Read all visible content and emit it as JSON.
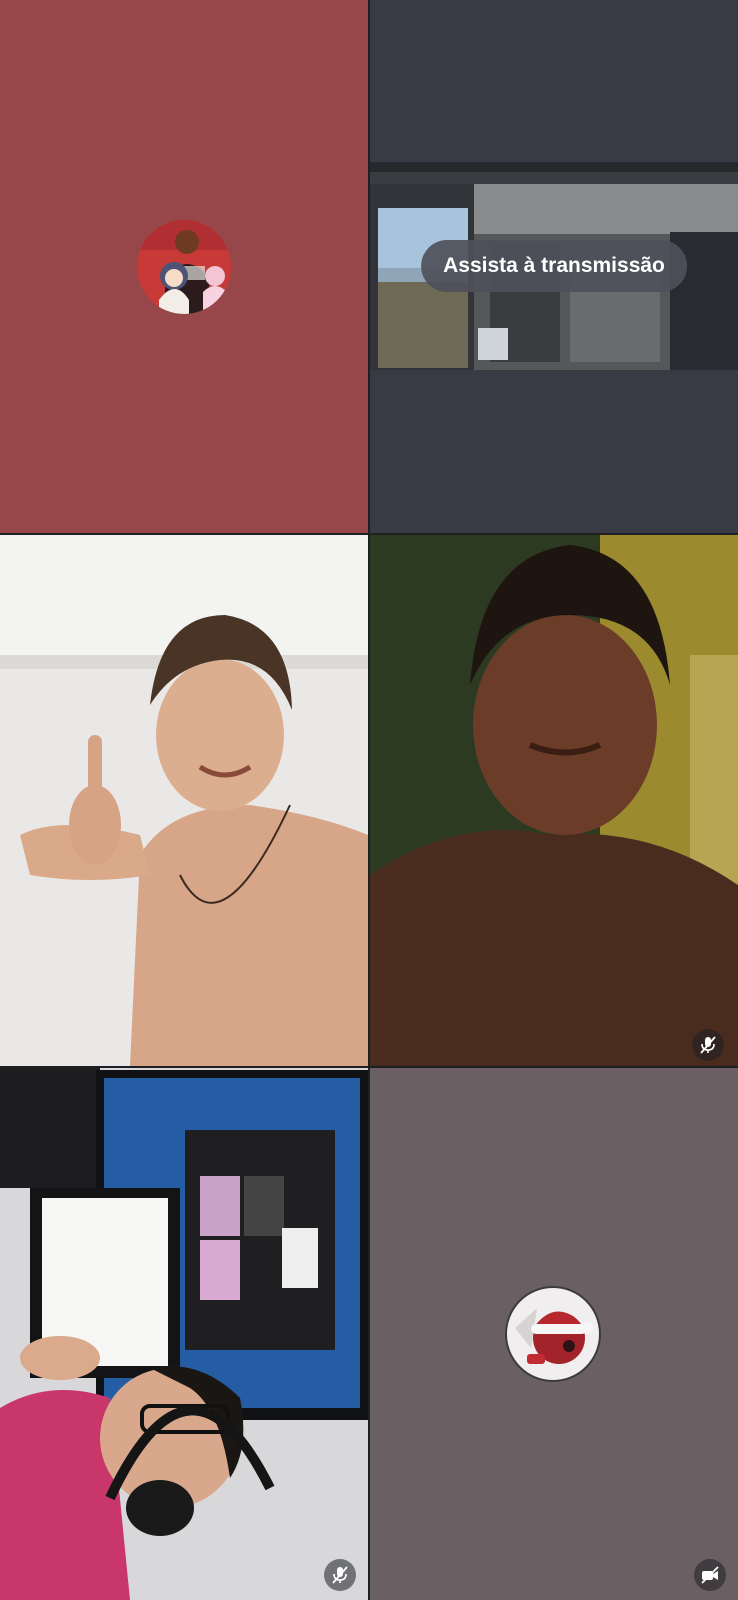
{
  "stream": {
    "watch_label": "Assista à transmissão"
  },
  "tiles": [
    {
      "kind": "avatar",
      "background": "#974649"
    },
    {
      "kind": "screen-share",
      "background": "#383a44"
    },
    {
      "kind": "video"
    },
    {
      "kind": "video",
      "icon": "mic-off-icon"
    },
    {
      "kind": "video",
      "icon": "mic-off-icon"
    },
    {
      "kind": "avatar",
      "background": "#6a5f62",
      "icon": "video-off-icon"
    }
  ]
}
